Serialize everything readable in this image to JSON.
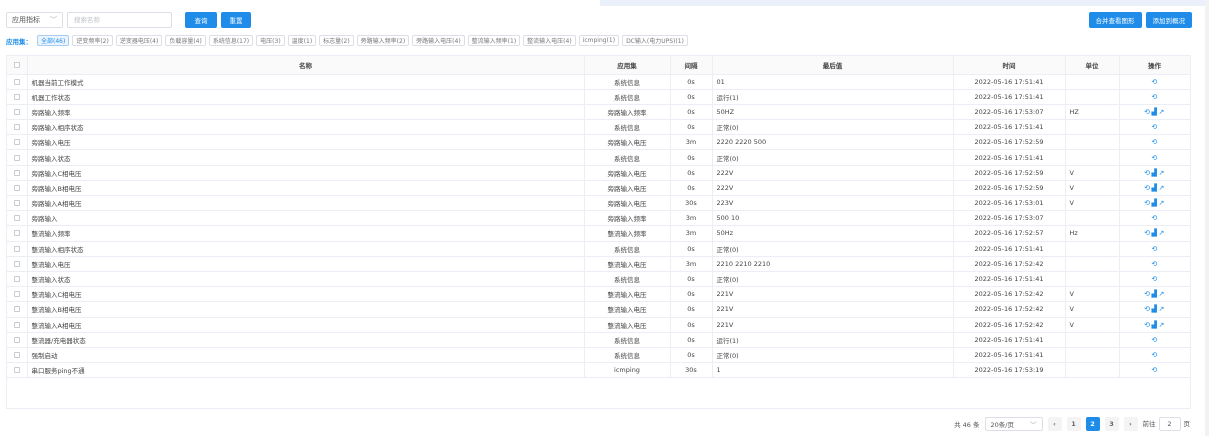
{
  "filter": {
    "select_value": "应用指标",
    "search_placeholder": "搜索名称",
    "query_label": "查询",
    "reset_label": "重置"
  },
  "actions": {
    "merge_view_label": "合并查看图形",
    "add_task_label": "添加到概况"
  },
  "tags": {
    "label": "应用集：",
    "items": [
      "全部(46)",
      "逆变频率(2)",
      "逆变器电压(4)",
      "负载容量(4)",
      "系统信息(17)",
      "电压(3)",
      "温度(1)",
      "标志量(2)",
      "旁路输入频率(2)",
      "旁路输入电压(4)",
      "整流输入频率(1)",
      "整流输入电压(4)",
      "icmping(1)",
      "DC输入(电力UPS)(1)"
    ]
  },
  "table": {
    "headers": {
      "name": "名称",
      "app": "应用集",
      "interval": "间隔",
      "last": "最后值",
      "time": "时间",
      "unit": "单位",
      "ops": "操作"
    },
    "rows": [
      {
        "name": "机器当前工作模式",
        "app": "系统信息",
        "interval": "0s",
        "last": "01",
        "time": "2022-05-16 17:51:41",
        "unit": "",
        "full": false
      },
      {
        "name": "机器工作状态",
        "app": "系统信息",
        "interval": "0s",
        "last": "运行(1)",
        "time": "2022-05-16 17:51:41",
        "unit": "",
        "full": false
      },
      {
        "name": "旁路输入频率",
        "app": "旁路输入频率",
        "interval": "0s",
        "last": "50HZ",
        "time": "2022-05-16 17:53:07",
        "unit": "HZ",
        "full": true
      },
      {
        "name": "旁路输入相序状态",
        "app": "系统信息",
        "interval": "0s",
        "last": "正常(0)",
        "time": "2022-05-16 17:51:41",
        "unit": "",
        "full": false
      },
      {
        "name": "旁路输入电压",
        "app": "旁路输入电压",
        "interval": "3m",
        "last": "2220 2220 500",
        "time": "2022-05-16 17:52:59",
        "unit": "",
        "full": false
      },
      {
        "name": "旁路输入状态",
        "app": "系统信息",
        "interval": "0s",
        "last": "正常(0)",
        "time": "2022-05-16 17:51:41",
        "unit": "",
        "full": false
      },
      {
        "name": "旁路输入C相电压",
        "app": "旁路输入电压",
        "interval": "0s",
        "last": "222V",
        "time": "2022-05-16 17:52:59",
        "unit": "V",
        "full": true
      },
      {
        "name": "旁路输入B相电压",
        "app": "旁路输入电压",
        "interval": "0s",
        "last": "222V",
        "time": "2022-05-16 17:52:59",
        "unit": "V",
        "full": true
      },
      {
        "name": "旁路输入A相电压",
        "app": "旁路输入电压",
        "interval": "30s",
        "last": "223V",
        "time": "2022-05-16 17:53:01",
        "unit": "V",
        "full": true
      },
      {
        "name": "旁路输入",
        "app": "旁路输入频率",
        "interval": "3m",
        "last": "500 10",
        "time": "2022-05-16 17:53:07",
        "unit": "",
        "full": false
      },
      {
        "name": "整流输入频率",
        "app": "整流输入频率",
        "interval": "3m",
        "last": "50Hz",
        "time": "2022-05-16 17:52:57",
        "unit": "Hz",
        "full": true
      },
      {
        "name": "整流输入相序状态",
        "app": "系统信息",
        "interval": "0s",
        "last": "正常(0)",
        "time": "2022-05-16 17:51:41",
        "unit": "",
        "full": false
      },
      {
        "name": "整流输入电压",
        "app": "整流输入电压",
        "interval": "3m",
        "last": "2210 2210 2210",
        "time": "2022-05-16 17:52:42",
        "unit": "",
        "full": false
      },
      {
        "name": "整流输入状态",
        "app": "系统信息",
        "interval": "0s",
        "last": "正常(0)",
        "time": "2022-05-16 17:51:41",
        "unit": "",
        "full": false
      },
      {
        "name": "整流输入C相电压",
        "app": "整流输入电压",
        "interval": "0s",
        "last": "221V",
        "time": "2022-05-16 17:52:42",
        "unit": "V",
        "full": true
      },
      {
        "name": "整流输入B相电压",
        "app": "整流输入电压",
        "interval": "0s",
        "last": "221V",
        "time": "2022-05-16 17:52:42",
        "unit": "V",
        "full": true
      },
      {
        "name": "整流输入A相电压",
        "app": "整流输入电压",
        "interval": "0s",
        "last": "221V",
        "time": "2022-05-16 17:52:42",
        "unit": "V",
        "full": true
      },
      {
        "name": "整流器/充电器状态",
        "app": "系统信息",
        "interval": "0s",
        "last": "运行(1)",
        "time": "2022-05-16 17:51:41",
        "unit": "",
        "full": false
      },
      {
        "name": "强制启动",
        "app": "系统信息",
        "interval": "0s",
        "last": "正常(0)",
        "time": "2022-05-16 17:51:41",
        "unit": "",
        "full": false
      },
      {
        "name": "串口服务ping不通",
        "app": "icmping",
        "interval": "30s",
        "last": "1",
        "time": "2022-05-16 17:53:19",
        "unit": "",
        "full": false
      }
    ]
  },
  "pagination": {
    "total_text": "共 46 条",
    "page_size": "20条/页",
    "pages": [
      "1",
      "2",
      "3"
    ],
    "current": "2",
    "goto_label": "前往",
    "goto_value": "2",
    "page_suffix": "页",
    "prev_icon": "‹",
    "next_icon": "›"
  },
  "colors": {
    "primary": "#1e8ce8",
    "border": "#ebeef5",
    "header_bg": "#fafafa"
  },
  "icons": {
    "ops": [
      "history-icon",
      "chart-icon",
      "external-link-icon"
    ]
  }
}
